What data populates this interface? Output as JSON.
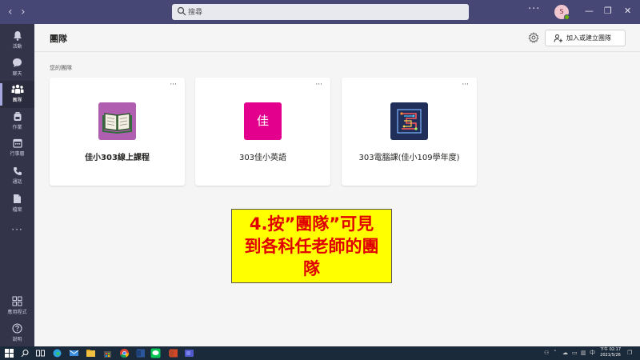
{
  "window": {
    "search_placeholder": "搜尋",
    "avatar_initial": "S",
    "nav_back": "‹",
    "nav_forward": "›",
    "more": "···",
    "minimize": "—",
    "restore": "❐",
    "close": "✕"
  },
  "rail": {
    "items": [
      {
        "label": "活動",
        "icon": "bell-icon"
      },
      {
        "label": "聊天",
        "icon": "chat-icon"
      },
      {
        "label": "團隊",
        "icon": "teams-icon",
        "active": true
      },
      {
        "label": "作業",
        "icon": "backpack-icon"
      },
      {
        "label": "行事曆",
        "icon": "calendar-icon"
      },
      {
        "label": "通話",
        "icon": "phone-icon"
      },
      {
        "label": "檔案",
        "icon": "file-icon"
      }
    ],
    "more": "···",
    "apps_label": "應用程式",
    "help_label": "說明"
  },
  "header": {
    "title": "團隊",
    "join_button": "加入或建立團隊"
  },
  "section_label": "您的團隊",
  "teams": [
    {
      "name": "佳小303線上課程",
      "tile_color": "#b05fb0",
      "icon": "book-icon",
      "more": "···"
    },
    {
      "name": "303佳小英語",
      "tile_color": "#e3008c",
      "tile_text": "佳",
      "more": "···"
    },
    {
      "name": "303電腦課(佳小109學年度)",
      "tile_color": "#1f2f5a",
      "icon": "circuit-icon",
      "more": "···"
    }
  ],
  "annotation": {
    "lines": [
      "4.按”團隊”可見",
      "到各科任老師的團",
      "隊"
    ]
  },
  "taskbar": {
    "time": "下午 02:17",
    "date": "2021/5/26",
    "tray_language": "中",
    "tray_notification": "❐"
  },
  "colors": {
    "titlebar": "#464775",
    "rail": "#33344a",
    "accent": "#a6a7dc",
    "annotation_bg": "#ffff00",
    "annotation_text": "#e00000"
  }
}
